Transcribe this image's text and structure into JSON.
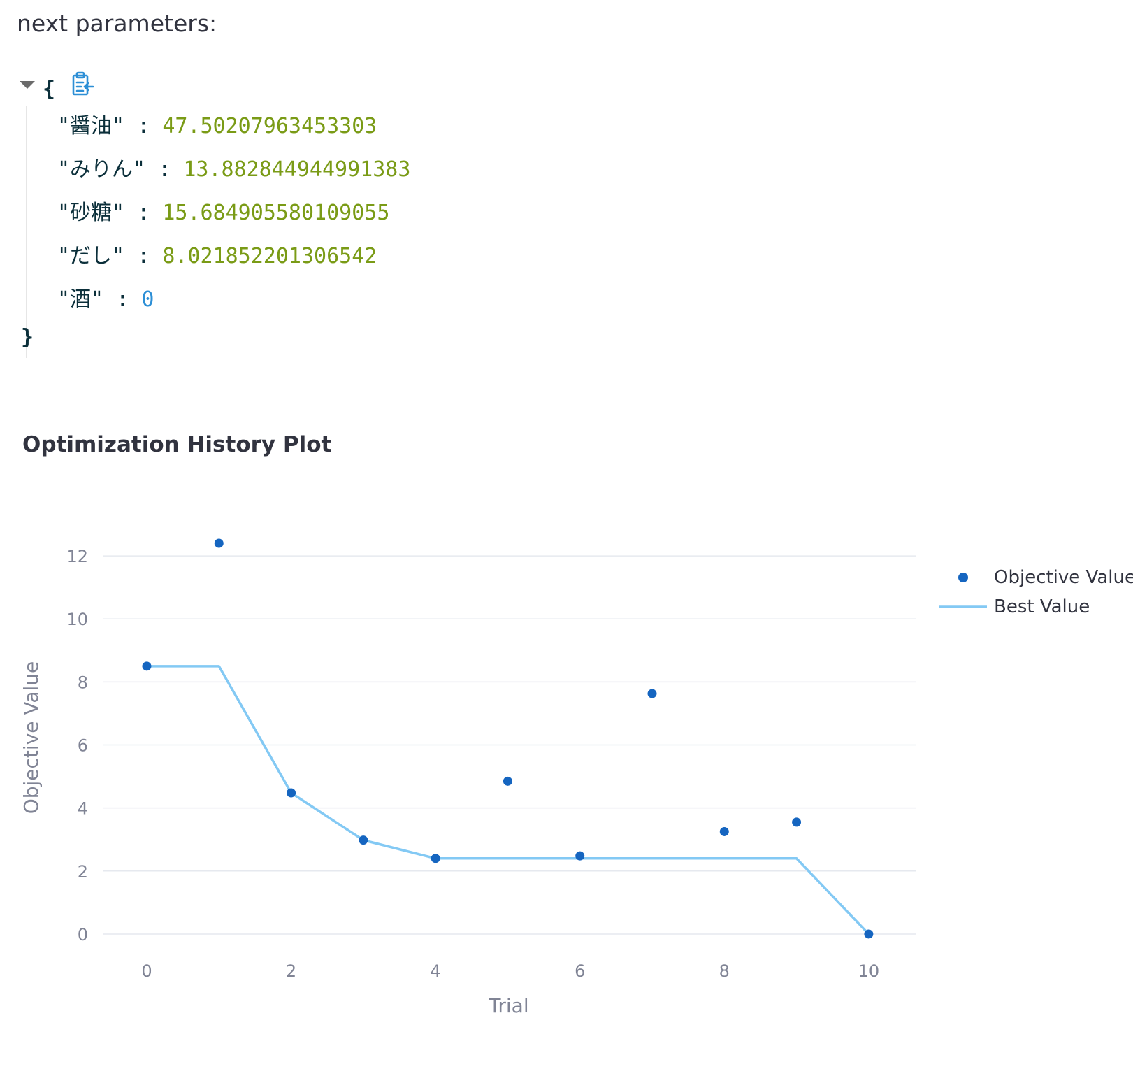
{
  "header": {
    "label": "next parameters:"
  },
  "json_viewer": {
    "open_brace": "{",
    "close_brace": "}",
    "entries": [
      {
        "key": "\"醤油\"",
        "colon": ":",
        "value": "47.50207963453303",
        "type": "float"
      },
      {
        "key": "\"みりん\"",
        "colon": ":",
        "value": "13.882844944991383",
        "type": "float"
      },
      {
        "key": "\"砂糖\"",
        "colon": ":",
        "value": "15.684905580109055",
        "type": "float"
      },
      {
        "key": "\"だし\"",
        "colon": ":",
        "value": "8.021852201306542",
        "type": "float"
      },
      {
        "key": "\"酒\"",
        "colon": ":",
        "value": "0",
        "type": "int"
      }
    ],
    "icons": {
      "toggle": "caret-down-icon",
      "copy": "clipboard-copy-icon"
    },
    "colors": {
      "float": "#7a9b16",
      "int": "#2d8fd6",
      "key": "#0b2f3a",
      "copy_icon": "#2d8fd6"
    }
  },
  "plot": {
    "title": "Optimization History Plot"
  },
  "chart_data": {
    "type": "scatter",
    "title": "Optimization History Plot",
    "xlabel": "Trial",
    "ylabel": "Objective Value",
    "xlim": [
      -0.6,
      10.65
    ],
    "ylim": [
      -0.8,
      13
    ],
    "xticks": [
      0,
      2,
      4,
      6,
      8,
      10
    ],
    "yticks": [
      0,
      2,
      4,
      6,
      8,
      10,
      12
    ],
    "grid": true,
    "legend_position": "top-right",
    "series": [
      {
        "name": "Objective Value",
        "type": "scatter",
        "color": "#1565c0",
        "x": [
          0,
          1,
          2,
          3,
          4,
          5,
          6,
          7,
          8,
          9,
          10
        ],
        "y": [
          8.5,
          12.4,
          4.48,
          2.98,
          2.4,
          4.85,
          2.48,
          7.63,
          3.25,
          3.55,
          0
        ]
      },
      {
        "name": "Best Value",
        "type": "line",
        "color": "#83c9f4",
        "x": [
          0,
          1,
          2,
          3,
          4,
          5,
          6,
          7,
          8,
          9,
          10
        ],
        "y": [
          8.5,
          8.5,
          4.48,
          2.98,
          2.4,
          2.4,
          2.4,
          2.4,
          2.4,
          2.4,
          0
        ]
      }
    ]
  }
}
